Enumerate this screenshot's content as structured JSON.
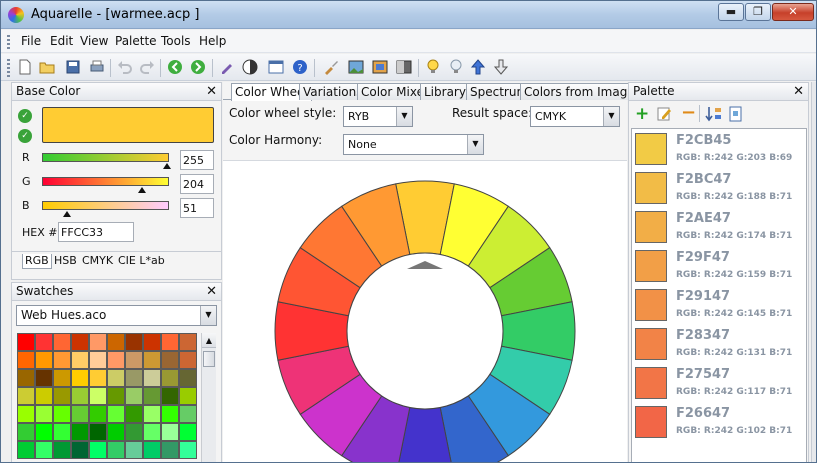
{
  "window": {
    "title": "Aquarelle - [warmee.acp ]",
    "min": "▬",
    "max": "❐",
    "close": "✕"
  },
  "menu": [
    "File",
    "Edit",
    "View",
    "Palette",
    "Tools",
    "Help"
  ],
  "toolbar_icons": [
    "new-file-icon",
    "open-folder-icon",
    "save-icon",
    "print-icon",
    "undo-icon",
    "redo-icon",
    "green-back-icon",
    "green-forward-icon",
    "pipette-icon",
    "contrast-icon",
    "preview-icon",
    "help-icon",
    "brush-icon",
    "image-icon",
    "image2-icon",
    "image3-icon",
    "bulb-icon",
    "bulb2-icon",
    "arrow-up-icon",
    "arrow-down-icon"
  ],
  "base_color": {
    "title": "Base Color",
    "close": "✕",
    "swatch_color": "#ffcc33",
    "r_label": "R",
    "g_label": "G",
    "b_label": "B",
    "r_value": "255",
    "g_value": "204",
    "b_value": "51",
    "hex_label": "HEX #",
    "hex_value": "FFCC33",
    "tabs": [
      "RGB",
      "HSB",
      "CMYK",
      "CIE L*ab"
    ]
  },
  "swatches": {
    "title": "Swatches",
    "close": "✕",
    "selected": "Web Hues.aco",
    "colors": [
      "#ff0000",
      "#ff3333",
      "#ff6633",
      "#cc3300",
      "#ff9966",
      "#cc6600",
      "#993300",
      "#cc3300",
      "#ff6633",
      "#cc6633",
      "#ff6600",
      "#ff9900",
      "#ff9933",
      "#ffcc66",
      "#ffcc99",
      "#ff9966",
      "#cc9966",
      "#cc9933",
      "#996633",
      "#cc6633",
      "#996600",
      "#663300",
      "#cc9900",
      "#ffcc00",
      "#ffcc33",
      "#cccc66",
      "#999966",
      "#cccc99",
      "#999933",
      "#666633",
      "#cccc33",
      "#cccc00",
      "#999900",
      "#99cc33",
      "#ccff66",
      "#669900",
      "#99cc66",
      "#669933",
      "#336600",
      "#99cc00",
      "#99ff00",
      "#99ff33",
      "#66ff00",
      "#66cc33",
      "#33cc00",
      "#66ff33",
      "#339900",
      "#99ff66",
      "#33ff00",
      "#66cc66",
      "#33cc33",
      "#00ff00",
      "#33ff33",
      "#009900",
      "#006600",
      "#00cc00",
      "#339933",
      "#66ff66",
      "#99ff99",
      "#00ff33",
      "#00cc33",
      "#33ff66",
      "#009933",
      "#006633",
      "#00ff66",
      "#33cc66",
      "#66cc99",
      "#00cc66",
      "#339966",
      "#33ff99"
    ]
  },
  "center": {
    "tabs": [
      "Color Wheel",
      "Variations",
      "Color Mixer",
      "Library",
      "Spectrum",
      "Colors from Image"
    ],
    "wheel_style_label": "Color wheel style:",
    "wheel_style_value": "RYB",
    "result_space_label": "Result space:",
    "result_space_value": "CMYK",
    "harmony_label": "Color Harmony:",
    "harmony_value": "None",
    "wheel_colors": [
      "#ffcc33",
      "#ffff33",
      "#ccee33",
      "#66cc33",
      "#33cc66",
      "#33ccaa",
      "#3399dd",
      "#3366cc",
      "#4433cc",
      "#8833cc",
      "#cc33cc",
      "#ee3377",
      "#ff3333",
      "#ff5533",
      "#ff7733",
      "#ff9933"
    ]
  },
  "palette": {
    "title": "Palette",
    "close": "✕",
    "items": [
      {
        "hex": "F2CB45",
        "rgb": "RGB: R:242 G:203 B:69",
        "color": "#f2cb45"
      },
      {
        "hex": "F2BC47",
        "rgb": "RGB: R:242 G:188 B:71",
        "color": "#f2bc47"
      },
      {
        "hex": "F2AE47",
        "rgb": "RGB: R:242 G:174 B:71",
        "color": "#f2ae47"
      },
      {
        "hex": "F29F47",
        "rgb": "RGB: R:242 G:159 B:71",
        "color": "#f29f47"
      },
      {
        "hex": "F29147",
        "rgb": "RGB: R:242 G:145 B:71",
        "color": "#f29147"
      },
      {
        "hex": "F28347",
        "rgb": "RGB: R:242 G:131 B:71",
        "color": "#f28347"
      },
      {
        "hex": "F27547",
        "rgb": "RGB: R:242 G:117 B:71",
        "color": "#f27547"
      },
      {
        "hex": "F26647",
        "rgb": "RGB: R:242 G:102 B:71",
        "color": "#f26647"
      }
    ]
  }
}
